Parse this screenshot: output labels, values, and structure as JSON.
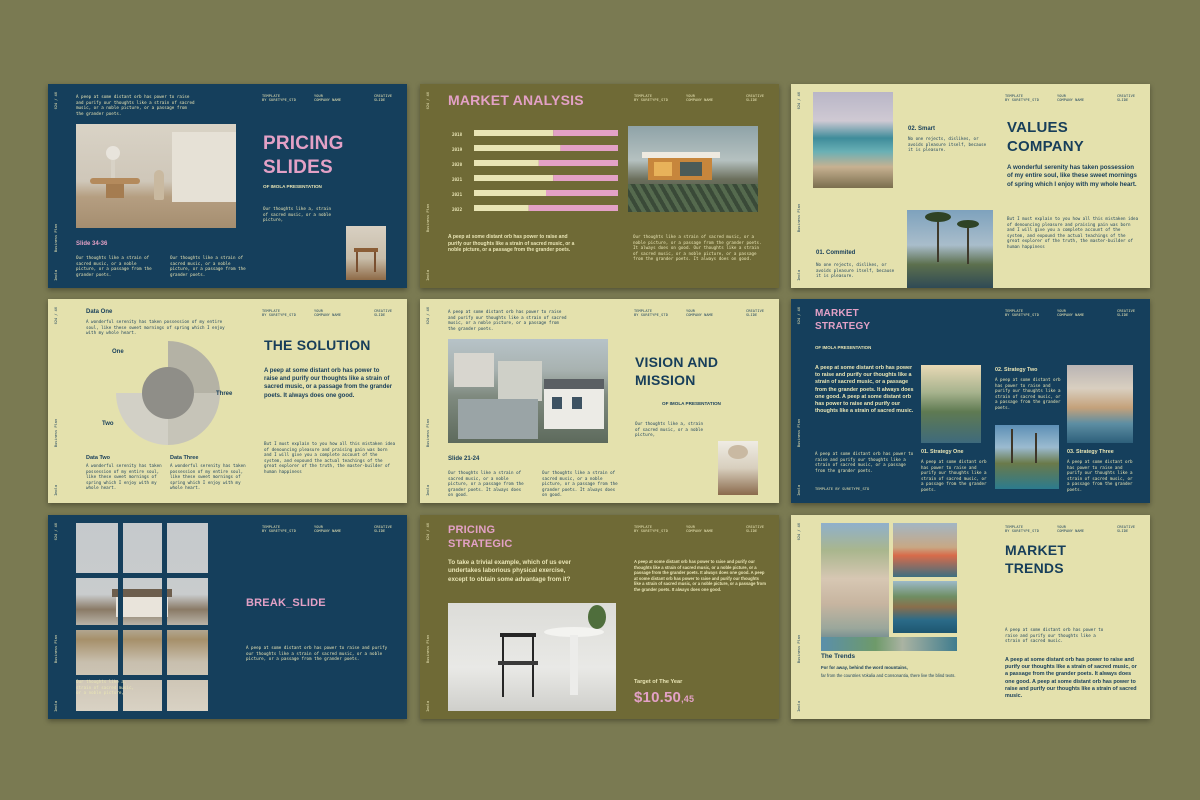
{
  "common": {
    "template_label": "TEMPLATE",
    "template_by": "BY SURETYPE_STD",
    "your_label": "YOUR",
    "company_name": "COMPANY NAME",
    "creative_label": "CREATIVE",
    "slide_label": "SLIDE",
    "side_title": "Business Plan",
    "side_subtitle": "Presentation Template",
    "side_brand": "Imola"
  },
  "s1": {
    "num": "024 / 40",
    "intro": "A peep at some distant orb has power to raise and purify our thoughts like a strain of sacred music, or a noble picture, or a passage from the grander poets.",
    "title_line1": "PRICING",
    "title_line2": "SLIDES",
    "subtitle": "OF IMOLA PRESENTATION",
    "thoughts": "Our thoughts like a, strain of sacred music, or a noble picture,",
    "slide_range": "Slide 34-36",
    "col1": "Our thoughts like a strain of sacred music, or a noble picture, or a passage from the grander poets.",
    "col2": "Our thoughts like a strain of sacred music, or a noble picture, or a passage from the grander poets."
  },
  "s2": {
    "num": "024 / 40",
    "title": "MARKET ANALYSIS",
    "bar_caption": "A peep at some distant orb has power to raise and purify our thoughts like a strain of sacred music, or a noble picture, or a passage from the grander poets.",
    "right_text": "Our thoughts like a strain of sacred music, or a noble picture, or a passage from the grander poets. It always does on good. Our thoughts like a strain of sacred music, or a noble picture, or a passage from the grander poets. It always does on good."
  },
  "chart_data": {
    "type": "bar",
    "categories": [
      "2018",
      "2019",
      "2020",
      "2021",
      "2021",
      "2022"
    ],
    "series": [
      {
        "values": [
          55,
          60,
          45,
          55,
          50,
          38
        ]
      },
      {
        "values": [
          45,
          40,
          55,
          45,
          50,
          62
        ]
      }
    ],
    "ylim": [
      0,
      100
    ],
    "colors": [
      "#e9e5b5",
      "#e3a1c6"
    ]
  },
  "s3": {
    "num": "024 / 40",
    "smart_title": "02. Smart",
    "smart_text": "No one rejects, dislikes, or avoids pleasure itself, because it is pleasure.",
    "title_line1": "VALUES",
    "title_line2": "COMPANY",
    "lead": "A wonderful serenity has taken possession of my entire soul, like these sweet mornings of spring which I enjoy with my whole heart.",
    "body": "But I must explain to you how all this mistaken idea of denouncing pleasure and praising pain was born and I will give you a complete account of the system, and expound the actual teachings of the great explorer of the truth, the master-builder of human happiness",
    "commit_title": "01. Commited",
    "commit_text": "No one rejects, dislikes, or avoids pleasure itself, because it is pleasure."
  },
  "s4": {
    "num": "024 / 40",
    "data_one": "Data One",
    "data_one_text": "A wonderful serenity has taken possession of my entire soul, like these sweet mornings of spring which I enjoy with my whole heart.",
    "label_one": "One",
    "label_two": "Two",
    "label_three": "Three",
    "title": "THE SOLUTION",
    "lead": "A peep at some distant orb has power to raise and purify our thoughts like a strain of sacred music, or a passage from the grander poets. It always does one good.",
    "body": "But I must explain to you how all this mistaken idea of denouncing pleasure and praising pain was born and I will give you a complete account of the system, and expound the actual teachings of the great explorer of the truth, the master-builder of human happiness",
    "data_two": "Data Two",
    "data_two_text": "A wonderful serenity has taken possession of my entire soul, like these sweet mornings of spring which I enjoy with my whole heart.",
    "data_three": "Data Three",
    "data_three_text": "A wonderful serenity has taken possession of my entire soul, like these sweet mornings of spring which I enjoy with my whole heart."
  },
  "s5": {
    "num": "024 / 40",
    "intro": "A peep at some distant orb has power to raise and purify our thoughts like a strain of sacred music, or a noble picture, or a passage from the grander poets.",
    "title_line1": "VISION AND",
    "title_line2": "MISSION",
    "subtitle": "OF IMOLA PRESENTATION",
    "thoughts": "Our thoughts like a, strain of sacred music, or a noble picture,",
    "slide_range": "Slide 21-24",
    "col1": "Our thoughts like a strain of sacred music, or a noble picture, or a passage from the grander poets. It always does on good.",
    "col2": "Our thoughts like a strain of sacred music, or a noble picture, or a passage from the grander poets. It always does on good."
  },
  "s6": {
    "num": "024 / 40",
    "title_line1": "MARKET",
    "title_line2": "STRATEGY",
    "subtitle": "OF IMOLA PRESENTATION",
    "lead": "A peep at some distant orb has power to raise and purify our thoughts like a strain of sacred music, or a passage from the grander poets. It always does one good. A peep at some distant orb has power to raise and purify our thoughts like a strain of sacred music.",
    "left_small": "A peep at some distant orb has power to raise and purify our thoughts like a strain of sacred music, or a passage from the grander poets.",
    "s1_title": "01. Strategy One",
    "s1_text": "A peep at some distant orb has power to raise and purify our thoughts like a strain of sacred music, or a passage from the grander poets.",
    "s2_title": "02. Strategy Two",
    "s2_text": "A peep at some distant orb has power to raise and purify our thoughts like a strain of sacred music, or a passage from the grander poets.",
    "s3_title": "03. Strategy Three",
    "s3_text": "A peep at some distant orb has power to raise and purify our thoughts like a strain of sacred music, or a passage from the grander poets."
  },
  "s7": {
    "num": "024 / 40",
    "title": "BREAK_SLIDE",
    "body": "A peep at some distant orb has power to raise and purify our thoughts like a strain of sacred music, or a noble picture, or a passage from the grander poets.",
    "thoughts": "Our thoughts like a, strain of sacred music, or a noble picture,"
  },
  "s8": {
    "num": "024 / 40",
    "title_line1": "PRICING",
    "title_line2": "STRATEGIC",
    "lead": "To take a trivial example, which of us ever undertakes laborious physical exercise, except to obtain some advantage from it?",
    "right_text": "A peep at some distant orb has power to raise and purify our thoughts like a strain of sacred music, or a noble picture, or a passage from the grander poets. It always does one good. A peep at some distant orb has power to raise and purify our thoughts like a strain of sacred music, or a noble picture, or a passage from the grander poets. It always does one good.",
    "target_label": "Target of The Year",
    "price_main": "$10.50",
    "price_sub": ",45"
  },
  "s9": {
    "num": "024 / 40",
    "title_line1": "MARKET",
    "title_line2": "TRENDS",
    "trends_title": "The Trends",
    "trends_lead": "For for away, behind the word mountains,",
    "trends_text": "far from the countries Vokalia and Consonantia, there live the blind texts.",
    "small": "A peep at some distant orb has power to raise and purify our thoughts like a strain of sacred music.",
    "lead": "A peep at some distant orb has power to raise and purify our thoughts like a strain of sacred music, or a passage from the grander poets. It always does one good. A peep at some distant orb has power to raise and purify our thoughts like a strain of sacred music."
  }
}
